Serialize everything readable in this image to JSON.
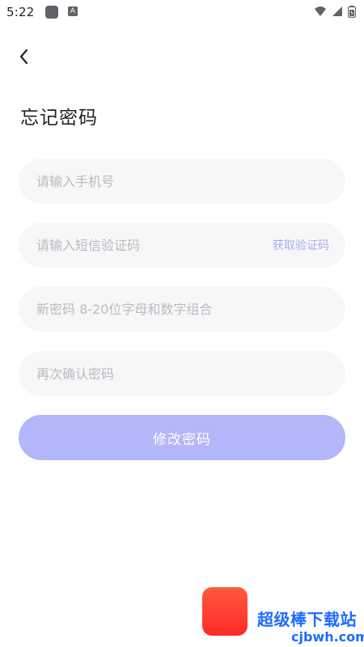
{
  "status_bar": {
    "time": "5:22",
    "icons": [
      "square-app-icon",
      "a-app-icon",
      "wifi-icon",
      "signal-icon",
      "battery-icon"
    ]
  },
  "header": {
    "title": "忘记密码"
  },
  "form": {
    "phone_placeholder": "请输入手机号",
    "sms_code_placeholder": "请输入短信验证码",
    "get_code_label": "获取验证码",
    "new_password_placeholder": "新密码 8-20位字母和数字组合",
    "confirm_password_placeholder": "再次确认密码",
    "submit_label": "修改密码"
  },
  "watermark": {
    "text": "超级棒下载站",
    "url": "cjbwh.com"
  },
  "colors": {
    "primary_button": "#b3b6f8",
    "link": "#a8acf0",
    "field_bg": "#f7f7f8",
    "placeholder": "#b9bbc2"
  }
}
